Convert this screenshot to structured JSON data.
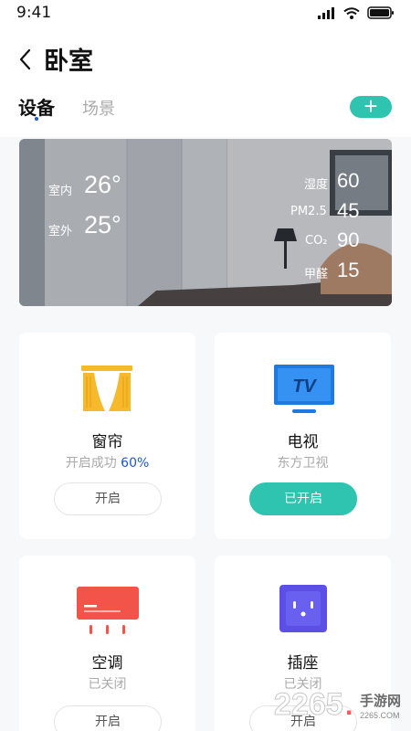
{
  "status_bar": {
    "time": "9:41"
  },
  "header": {
    "title": "卧室",
    "tabs": [
      {
        "label": "设备",
        "active": true
      },
      {
        "label": "场景",
        "active": false
      }
    ],
    "add_label": "+"
  },
  "environment": {
    "indoor": {
      "label": "室内",
      "value": "26°"
    },
    "outdoor": {
      "label": "室外",
      "value": "25°"
    },
    "humidity": {
      "label": "湿度",
      "value": "60"
    },
    "pm25": {
      "label": "PM2.5",
      "value": "45"
    },
    "co2": {
      "label": "CO₂",
      "value": "90"
    },
    "formaldehyde": {
      "label": "甲醛",
      "value": "15"
    }
  },
  "devices": [
    {
      "name": "窗帘",
      "status": "开启成功",
      "status_value": "60%",
      "button": "开启",
      "on": false,
      "icon": "curtain-icon"
    },
    {
      "name": "电视",
      "status": "东方卫视",
      "button": "已开启",
      "on": true,
      "icon": "tv-icon",
      "icon_text": "TV"
    },
    {
      "name": "空调",
      "status": "已关闭",
      "button": "开启",
      "on": false,
      "icon": "air-conditioner-icon"
    },
    {
      "name": "插座",
      "status": "已关闭",
      "button": "开启",
      "on": false,
      "icon": "socket-icon"
    }
  ],
  "watermark": {
    "number": "2265",
    "dot": ".",
    "site": "手游网",
    "domain": "2265.COM"
  },
  "colors": {
    "accent": "#2ec4b0",
    "primary_blue": "#1e59c8",
    "curtain": "#f6b92b",
    "tv": "#1f7ae0",
    "ac": "#f2544a",
    "socket": "#5b4fe6"
  }
}
